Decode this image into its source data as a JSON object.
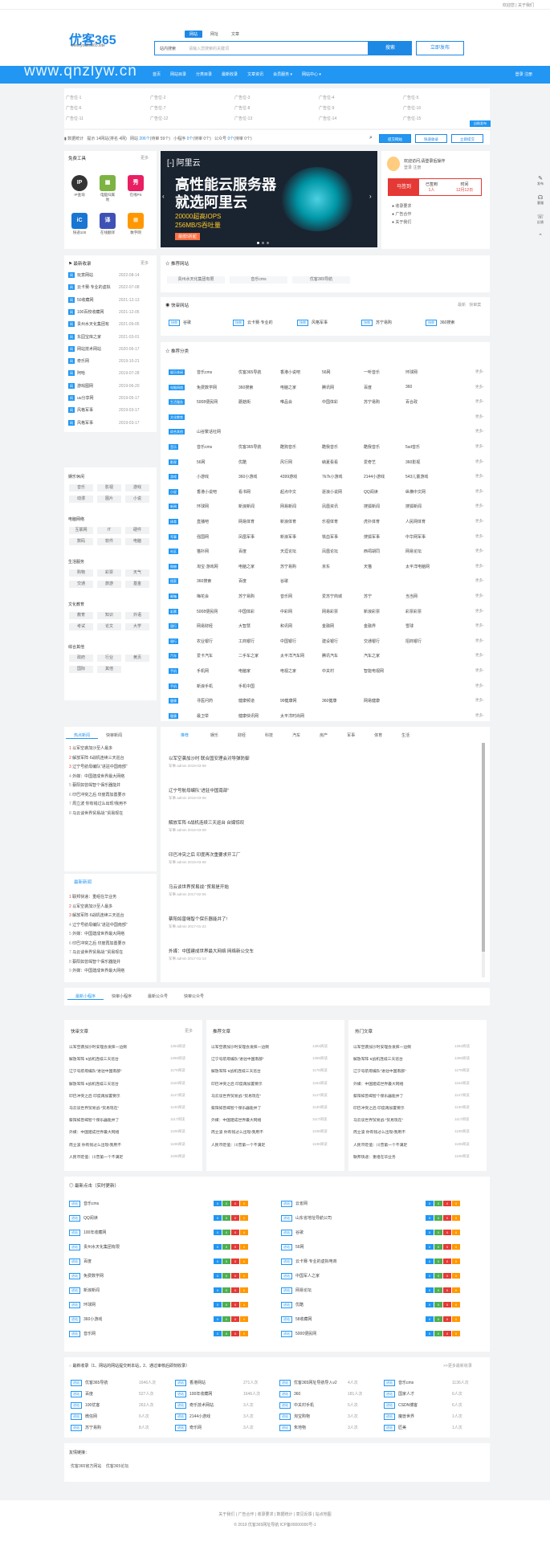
{
  "topbar": {
    "links": "欢迎您 | 关于我们"
  },
  "header": {
    "logo": "优客365",
    "logo_sub": "www.youke365.site",
    "watermark": "www.qnzlyw.cn",
    "search_tabs": [
      "网站",
      "网址",
      "文章"
    ],
    "search_category": "站内搜索",
    "search_placeholder": "请输入您搜索的关键词",
    "search_button": "搜索",
    "publish_button": "立即发布"
  },
  "nav": {
    "items": [
      "首页",
      "网站目录",
      "分类目录",
      "最新收录",
      "文章资讯",
      "会员服务 ▾",
      "网站中心 ▾"
    ],
    "login": "登录 注册"
  },
  "ads": [
    "广告位-1",
    "广告位-2",
    "广告位-3",
    "广告位-4",
    "广告位-5",
    "广告位-6",
    "广告位-7",
    "广告位-8",
    "广告位-9",
    "广告位-10",
    "广告位-11",
    "广告位-12",
    "广告位-13",
    "广告位-14",
    "广告位-15"
  ],
  "ad_button": "自助发布",
  "stats": {
    "label": "数据统计",
    "text1": "提示 14网站(排名 4网)",
    "text2": "网站",
    "n1": "206个",
    "t2": "(待审 59个)",
    "t3": "小程序",
    "n2": "0个",
    "t4": "(待审 0个)",
    "t5": "公众号",
    "n3": "0个",
    "t6": "(待审 0个)"
  },
  "stat_buttons": [
    "提交网站",
    "快速收录",
    "立即提交"
  ],
  "tools": {
    "title": "免费工具",
    "more": "更多",
    "items": [
      "IP查询",
      "电脑归属地",
      "在线PS",
      "快递100",
      "在线翻译",
      "数字网"
    ]
  },
  "banner": {
    "brand": "阿里云",
    "h1": "高性能云服务器",
    "h2": "就选阿里云",
    "sub1": "20000超高IOPS",
    "sub2": "256MB/S吞吐量",
    "badge": "最低5折起"
  },
  "user": {
    "greet": "欢迎访问,请登录后操作",
    "links": "登录 注册",
    "sign": "马签到",
    "stat_a": "已签到",
    "stat_a2": "1人",
    "stat_b": "时间",
    "stat_b2": "12月12日",
    "menu": [
      "收录要求",
      "广告合作",
      "关于我们"
    ]
  },
  "recent": {
    "title": "最新收录",
    "more": "更多",
    "items": [
      [
        "玩意网站",
        "2022-08-14"
      ],
      [
        "云卡赛·专业的虚拟",
        "2022-07-08"
      ],
      [
        "50收藏网",
        "2021-12-13"
      ],
      [
        "100百校收藏网",
        "2021-12-05"
      ],
      [
        "贵州水天化集团有",
        "2021-09-05"
      ],
      [
        "东园宝库之家",
        "2021-03-01"
      ],
      [
        "网站技术网站",
        "2020-06-17"
      ],
      [
        "奇乐网",
        "2019-10-21"
      ],
      [
        "阿哈",
        "2019-07-28"
      ],
      [
        "游戏图网",
        "2019-06-20"
      ],
      [
        "uu分享网",
        "2019-05-17"
      ],
      [
        "风格军事",
        "2019-03-17"
      ],
      [
        "风格军事",
        "2019-03-17"
      ]
    ]
  },
  "recommend": {
    "title": "推荐网站",
    "items": [
      "贵州水天化集团有限",
      "音乐cms",
      "优客365导航"
    ]
  },
  "quick": {
    "title": "快审网站",
    "more1": "最新",
    "more2": "快审案",
    "items": [
      "谷歌",
      "云卡赛·专业的",
      "风格军事",
      "苏宁易购",
      "360搜索"
    ]
  },
  "cat_group_title": "推荐分类",
  "left_cats": [
    {
      "title": "娱乐休闲",
      "chips": [
        "音乐",
        "影视",
        "游戏",
        "动漫",
        "图片",
        "小说"
      ]
    },
    {
      "title": "电脑网络",
      "chips": [
        "互联网",
        "IT",
        "硬件",
        "数码",
        "软件",
        "电脑"
      ]
    },
    {
      "title": "生活服务",
      "chips": [
        "购物",
        "彩票",
        "天气",
        "交通",
        "旅游",
        "基金"
      ]
    },
    {
      "title": "文化教育",
      "chips": [
        "教育",
        "知识",
        "外语",
        "考试",
        "论文",
        "大学"
      ]
    },
    {
      "title": "综合其他",
      "chips": [
        "政府",
        "行业",
        "黄页",
        "国际",
        "其他"
      ]
    }
  ],
  "cat_rows": [
    [
      "娱乐休闲",
      "音乐cms",
      "优客365导航",
      "香港小说吧",
      "56网",
      "一听音乐",
      "环球网"
    ],
    [
      "电脑网络",
      "免费数学网",
      "360搜索",
      "电脑之家",
      "腾讯网",
      "百度",
      "360"
    ],
    [
      "生活服务",
      "5008便民网",
      "蘑菇街",
      "唯品会",
      "中国体彩",
      "苏宁易购",
      "百合政"
    ],
    [
      "文化教育",
      "",
      "",
      "",
      "",
      "",
      ""
    ],
    [
      "综合其他",
      "山谷繁话社网",
      "",
      "",
      "",
      "",
      ""
    ],
    [
      "音乐",
      "音乐cms",
      "优客365导航",
      "酷狗音乐",
      "酷我音乐",
      "酷我音乐",
      "5sd音乐"
    ],
    [
      "影视",
      "56网",
      "优酷",
      "风行网",
      "納夏看看",
      "爱奇艺",
      "360影视"
    ],
    [
      "游戏",
      "小游戏",
      "360小游戏",
      "4399游戏",
      "7k7k小游戏",
      "2144小游戏",
      "543儿童游戏"
    ],
    [
      "小说",
      "香港小说吧",
      "看书网",
      "起点中文",
      "逐浪小说网",
      "QQ阅读",
      "纵横中文网"
    ],
    [
      "新闻",
      "环球网",
      "新浪新闻",
      "网易新闻",
      "凤凰资讯",
      "搜狐新闻",
      "搜狐新闻"
    ],
    [
      "体育",
      "直播吧",
      "网易体育",
      "新浪体育",
      "乐视体育",
      "虎扑体育",
      "人民网体育"
    ],
    [
      "军事",
      "强国网",
      "凤凰军事",
      "新浪军事",
      "铁血军事",
      "搜狐军事",
      "中华网军事"
    ],
    [
      "社区",
      "猫扑网",
      "百度",
      "天涯论坛",
      "凤凰论坛",
      "西祠胡同",
      "网易论坛"
    ],
    [
      "购物",
      "淘宝·游戏网",
      "电脑之家",
      "苏宁易购",
      "京东",
      "天猫",
      "太平洋电脑网"
    ],
    [
      "搜索",
      "360搜索",
      "百度",
      "谷歌",
      "",
      "",
      ""
    ],
    [
      "邮箱",
      "梅花会",
      "苏宁易购",
      "音乐网",
      "爱苏宁商城",
      "苏宁",
      "当当网"
    ],
    [
      "彩票",
      "5008便民网",
      "中国体彩",
      "中彩网",
      "网易彩票",
      "新浪彩票",
      "彩票彩票"
    ],
    [
      "银行",
      "网易财经",
      "大智慧",
      "和讯网",
      "金融网",
      "金融界",
      "雪球"
    ],
    [
      "银行",
      "农业银行",
      "工商银行",
      "中国银行",
      "建设银行",
      "交通银行",
      "招商银行"
    ],
    [
      "汽车",
      "爱卡汽车",
      "二手车之家",
      "太平洋汽车网",
      "腾讯汽车",
      "汽车之家",
      ""
    ],
    [
      "手机",
      "手机网",
      "电脑家",
      "电视之家",
      "中关村",
      "智能电视网",
      ""
    ],
    [
      "手机",
      "新浪手机",
      "手机中国",
      "",
      "",
      "",
      ""
    ],
    [
      "健康",
      "寻医问药",
      "健康频道",
      "99健康网",
      "360健康",
      "网易健康",
      ""
    ],
    [
      "健康",
      "最卫举",
      "健康快讯网",
      "太平洋时尚网",
      "",
      "",
      ""
    ]
  ],
  "hot_news": {
    "tabs": [
      "热点新闻",
      "快审新闻"
    ],
    "items": [
      "以军空袭加沙至人最多",
      "解放军阵·6战机连续三天巡台",
      "辽宁号航母编队“进驻中国南部”",
      "外媒：中国建成世界最大网络",
      "蔡阳如曾竭智个保乐器能并",
      "印巴冲突之后 印度再加置要示",
      "周立波 你有钱过么出现!我用不",
      "马云谈世界贸易战:“贸易现在"
    ]
  },
  "latest_news": {
    "title": "最新新闻",
    "items": [
      "联邦快递：重组在华业务",
      "以军空袭加沙至人最多",
      "解放军阵·6战机连续三天巡台",
      "辽宁号航母编队“进驻中国南部”",
      "外媒：中国建成世界最大网络",
      "印巴冲突之后 印度再加置要示",
      "马云谈世界贸易战:“贸易现在",
      "蔡阳如曾竭智个保乐器能并",
      "外媒：中国建成世界最大网络"
    ]
  },
  "article_tabs": [
    "推荐",
    "娱乐",
    "财经",
    "科技",
    "汽车",
    "房产",
    "军事",
    "体育",
    "生活"
  ],
  "articles": [
    [
      "以军空袭加沙时 联合国安理会对导弹防御",
      "2019-03-08"
    ],
    [
      "辽宁号航母编队“进驻中国南部”",
      "2019-03-08"
    ],
    [
      "解放军阵·6战机连续三天巡台 台媒惊叹",
      "2019-03-08"
    ],
    [
      "印巴冲突之后 印度再次重要求开工厂",
      "2019-03-08"
    ],
    [
      "马云谈世界贸易战:“贸易是开始",
      "2017-02-06"
    ],
    [
      "蔡阳如曾竭智个保乐器能并了!",
      "2017-01-22"
    ],
    [
      "外媒：中国建成世界最大网络 网络新公交车",
      "2017-01-14"
    ]
  ],
  "mini_tabs": [
    "最新小程序",
    "快审小程序",
    "最新公众号",
    "快审公众号"
  ],
  "col3": [
    {
      "title": "快审文章",
      "more": "更多",
      "items": [
        "以军空袭加沙时安理会发挥一边倒",
        "解放军阵·6战机连续三天巡台",
        "辽宁号航母编队“进驻中国南部”",
        "解放军阵·6战机连续三天巡台",
        "印巴冲突之后 印度再加置要示",
        "马云谈世界贸易战:“贸易现在”",
        "蔡阳如曾竭智个保乐器能并了",
        "外媒：中国建成世界最大网络",
        "周立波 你有钱过么出现!我用不",
        "人民币贬值：川普第一个不满足"
      ],
      "views": [
        "1284阅读",
        "1280阅读",
        "1179阅读",
        "1163阅读",
        "1147阅读",
        "1130阅读",
        "1117阅读",
        "1108阅读",
        "1108阅读",
        "1108阅读"
      ]
    },
    {
      "title": "推荐文章",
      "more": "",
      "items": [
        "以军空袭加沙时安理会发挥一边倒",
        "辽宁号航母编队“进驻中国南部”",
        "解放军阵·6战机连续三天巡台",
        "印巴冲突之后 印度再加置要示",
        "马云谈世界贸易战:“贸易现在”",
        "蔡阳如曾竭智个保乐器能并了",
        "外媒：中国建成世界最大网络",
        "周立波 你有钱过么出现!我用不",
        "人民币贬值：川普第一个不满足"
      ],
      "views": [
        "1284阅读",
        "1280阅读",
        "1179阅读",
        "1163阅读",
        "1147阅读",
        "1130阅读",
        "1117阅读",
        "1108阅读",
        "1108阅读"
      ]
    },
    {
      "title": "热门文章",
      "more": "",
      "items": [
        "以军空袭加沙时安理会发挥一边倒",
        "解放军阵·6战机连续三天巡台",
        "辽宁号航母编队“进驻中国南部”",
        "外媒：中国建成世界最大网络",
        "蔡阳如曾竭智个保乐器能并了",
        "印巴冲突之后 印度再加置要示",
        "马云谈世界贸易战:“贸易现在”",
        "周立波 你有钱过么出现!我用不",
        "人民币贬值：川普第一个不满足",
        "联邦快递：重组在华业务"
      ],
      "views": [
        "1284阅读",
        "1280阅读",
        "1179阅读",
        "1163阅读",
        "1147阅读",
        "1130阅读",
        "1117阅读",
        "1108阅读",
        "1108阅读",
        "1108阅读"
      ]
    }
  ],
  "rank": {
    "title": "最新点击（实时更新）",
    "left": [
      "音乐cms",
      "QQ阅读",
      "100年收藏网",
      "贵州水天化集团有限",
      "百度",
      "免费数学网",
      "新浪新闻",
      "环球网",
      "360小游戏",
      "音乐网"
    ],
    "right": [
      "云雀网",
      "山东省地址导航公司",
      "谷歌",
      "56网",
      "云卡赛·专业的虚拟电商",
      "中国军人之家",
      "网易论坛",
      "优酷",
      "58收藏网",
      "5000便民网"
    ]
  },
  "latest_submit": {
    "title": "最新收录（1、网站的网站提交到本站，2、通过审核后即刻收录）",
    "more": ">>更多最新收录",
    "cols": [
      [
        [
          "优客365导航",
          "1646人次"
        ],
        [
          "百度",
          "527人次"
        ],
        [
          "100优客",
          "263人次"
        ],
        [
          "微信网",
          "6人次"
        ],
        [
          "苏宁易购",
          "8人次"
        ]
      ],
      [
        [
          "香港网站",
          "271人次"
        ],
        [
          "100年收藏网",
          "1646人次"
        ],
        [
          "奇乐技术网站",
          "3人次"
        ],
        [
          "2144小游戏",
          "3人次"
        ],
        [
          "奇乐网",
          "3人次"
        ]
      ],
      [
        [
          "优客365网址导航导入v2",
          "4人次"
        ],
        [
          "360",
          "181人次"
        ],
        [
          "中关村手机",
          "5人次"
        ],
        [
          "淘宝购物",
          "3人次"
        ],
        [
          "朱地物",
          "3人次"
        ]
      ],
      [
        [
          "音乐cms",
          "1136人次"
        ],
        [
          "国家人才",
          "6人次"
        ],
        [
          "CSDN博客",
          "6人次"
        ],
        [
          "魔兽世界",
          "1人次"
        ],
        [
          "匠美",
          "1人次"
        ]
      ]
    ]
  },
  "friend": {
    "title": "友情链接：",
    "items": [
      "优客365官方网站",
      "优客365论坛"
    ]
  },
  "footer": {
    "links": "关于我们 | 广告合作 | 收录要求 | 数据统计 | 意见反馈 | 站点地图",
    "copy": "© 2019 优客365网址导航 ICP备00000000号-1"
  },
  "side": [
    "发布",
    "客服",
    "反馈",
    "顶部"
  ]
}
